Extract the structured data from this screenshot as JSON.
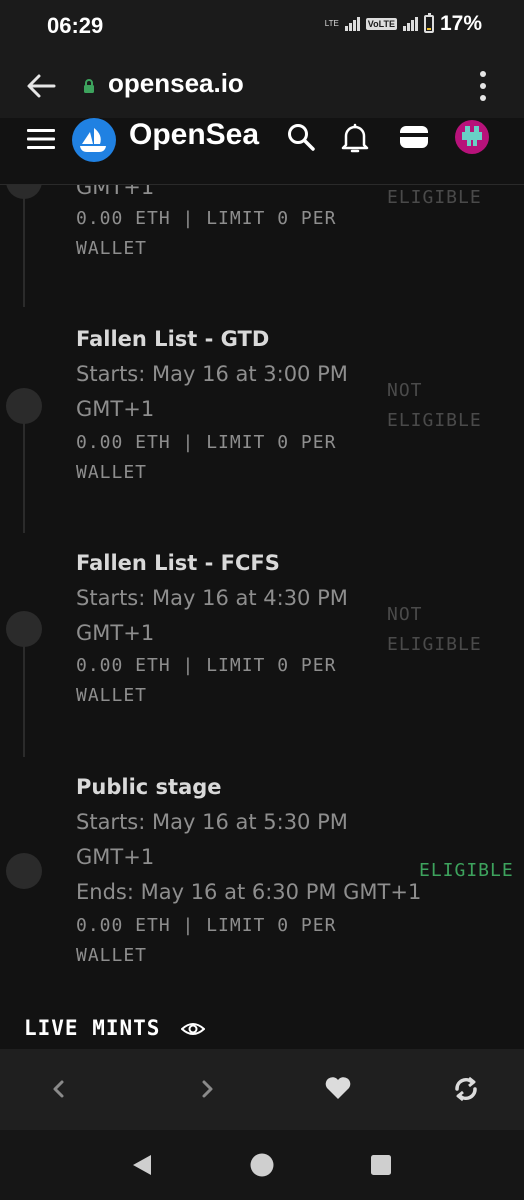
{
  "status_bar": {
    "time": "06:29",
    "network_label": "LTE",
    "volte_label": "VoLTE",
    "battery_percent": "17%",
    "battery_level": 0.17
  },
  "browser": {
    "url": "opensea.io"
  },
  "site_nav": {
    "brand": "OpenSea"
  },
  "stages": [
    {
      "title": "",
      "start_tail": "GMT+1",
      "price_line": "0.00 ETH | LIMIT 0 PER",
      "price_line2": "WALLET",
      "eligibility_line2": "ELIGIBLE"
    },
    {
      "title": "Fallen List - GTD",
      "starts": "Starts: May 16 at 3:00 PM",
      "starts_tz": "GMT+1",
      "price_line": "0.00 ETH | LIMIT 0 PER",
      "price_line2": "WALLET",
      "eligibility_line1": "NOT",
      "eligibility_line2": "ELIGIBLE"
    },
    {
      "title": "Fallen List - FCFS",
      "starts": "Starts: May 16 at 4:30 PM",
      "starts_tz": "GMT+1",
      "price_line": "0.00 ETH | LIMIT 0 PER",
      "price_line2": "WALLET",
      "eligibility_line1": "NOT",
      "eligibility_line2": "ELIGIBLE"
    },
    {
      "title": "Public stage",
      "starts": "Starts: May 16 at 5:30 PM",
      "starts_tz": "GMT+1",
      "ends": "Ends: May 16 at 6:30 PM GMT+1",
      "price_line": "0.00 ETH | LIMIT 0 PER",
      "price_line2": "WALLET",
      "eligibility": "ELIGIBLE"
    }
  ],
  "live_mints_label": "LIVE MINTS",
  "colors": {
    "background": "#121212",
    "eligible": "#3da35d",
    "not_eligible": "#4a4a4a",
    "opensea_blue": "#2081e2"
  }
}
